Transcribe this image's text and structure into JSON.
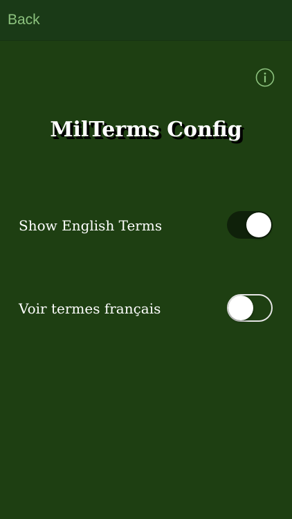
{
  "nav": {
    "back_label": "Back"
  },
  "header": {
    "title": "MilTerms Config",
    "info_icon": "info-circle-icon"
  },
  "settings": [
    {
      "label": "Show English Terms",
      "enabled": true
    },
    {
      "label": "Voir termes français",
      "enabled": false
    }
  ],
  "colors": {
    "background": "#1e3f12",
    "nav_background": "#1a3a17",
    "accent": "#8cc27e",
    "toggle_on_track": "#0f210a"
  }
}
